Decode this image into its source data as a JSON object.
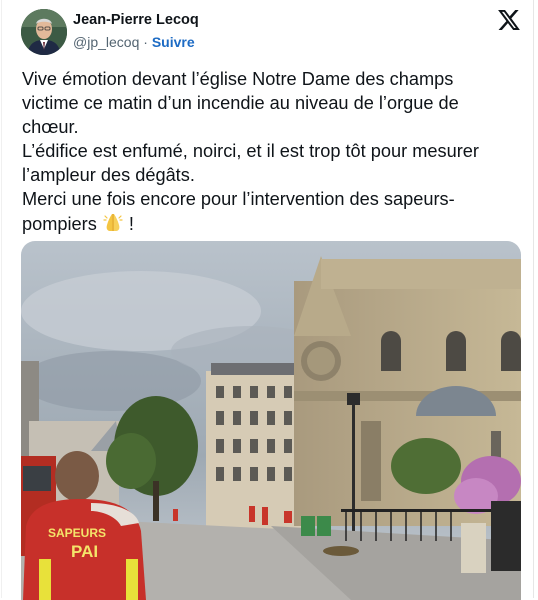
{
  "author": {
    "name": "Jean-Pierre Lecoq",
    "handle": "@jp_lecoq",
    "separator": " · ",
    "follow_label": "Suivre"
  },
  "header": {
    "logo_icon": "x-logo-icon"
  },
  "tweet": {
    "lines": [
      "Vive émotion devant l’église Notre Dame des champs",
      "victime ce matin d’un incendie au niveau de l’orgue de",
      "chœur.",
      "L’édifice est enfumé, noirci, et il est trop tôt pour mesurer",
      "l’ampleur des dégâts.",
      "Merci une fois encore pour l’intervention des sapeurs-"
    ],
    "last_line_text": "pompiers",
    "last_line_emoji": "folded-hands-emoji",
    "last_line_end": " !"
  },
  "media": {
    "jacket_text_1": "SAPEURS",
    "jacket_text_2": "PAI"
  },
  "colors": {
    "text": "#0f1419",
    "secondary": "#536471",
    "link": "#1d6bc4"
  }
}
